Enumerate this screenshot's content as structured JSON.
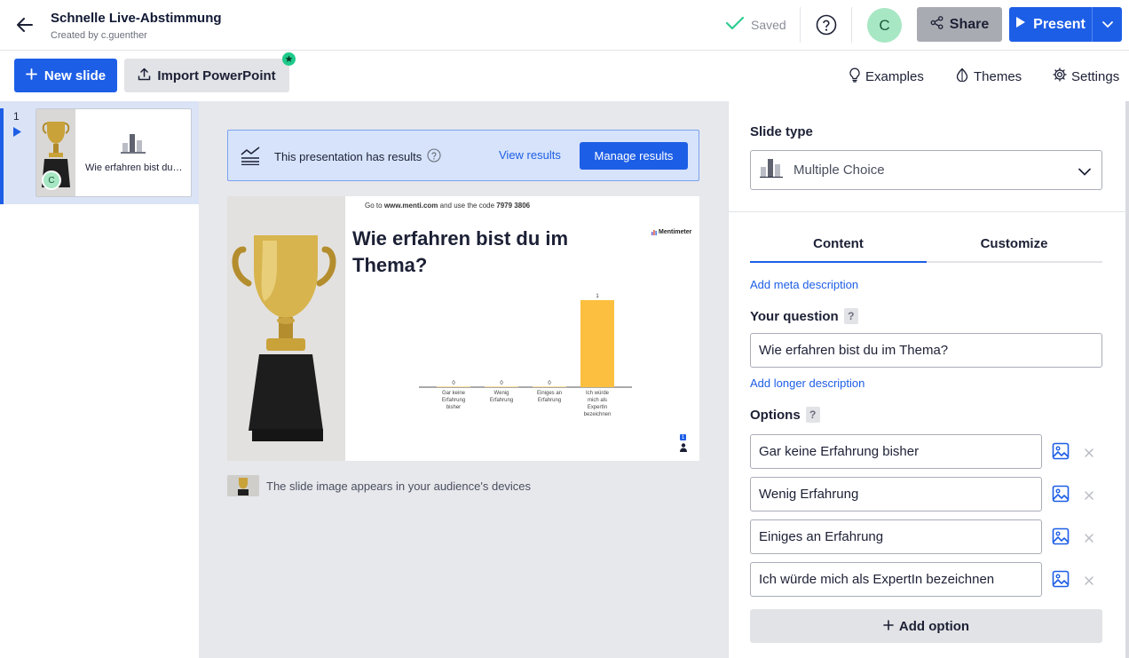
{
  "header": {
    "title": "Schnelle Live-Abstimmung",
    "created_by": "Created by c.guenther",
    "saved_label": "Saved",
    "avatar_initial": "C",
    "share_label": "Share",
    "present_label": "Present"
  },
  "toolbar": {
    "new_slide_label": "New slide",
    "import_label": "Import PowerPoint",
    "examples_label": "Examples",
    "themes_label": "Themes",
    "settings_label": "Settings"
  },
  "slides_panel": {
    "items": [
      {
        "number": "1",
        "title": "Wie erfahren bist du im Thema?",
        "avatar_initial": "C"
      }
    ]
  },
  "results_banner": {
    "text": "This presentation has results",
    "view_label": "View results",
    "manage_label": "Manage results"
  },
  "slide_preview": {
    "join_prefix": "Go to",
    "join_url": "www.menti.com",
    "join_middle": "and use the code",
    "join_code": "7979 3806",
    "question": "Wie erfahren bist du im Thema?",
    "brand": "Mentimeter",
    "audience_count": "1",
    "caption": "The slide image appears in your audience's devices"
  },
  "chart_data": {
    "type": "bar",
    "categories": [
      "Gar keine Erfahrung bisher",
      "Wenig Erfahrung",
      "Einiges an Erfahrung",
      "Ich würde mich als ExpertIn bezeichnen"
    ],
    "values": [
      0,
      0,
      0,
      1
    ],
    "colors": {
      "bar": "#fdbf3f",
      "axis": "#555555"
    }
  },
  "settings_panel": {
    "slide_type_label": "Slide type",
    "slide_type_value": "Multiple Choice",
    "tabs": [
      {
        "label": "Content"
      },
      {
        "label": "Customize"
      }
    ],
    "meta_link": "Add meta description",
    "question_label": "Your question",
    "question_value": "Wie erfahren bist du im Thema?",
    "longer_link": "Add longer description",
    "options_label": "Options",
    "options": [
      {
        "value": "Gar keine Erfahrung bisher"
      },
      {
        "value": "Wenig Erfahrung"
      },
      {
        "value": "Einiges an Erfahrung"
      },
      {
        "value": "Ich würde mich als ExpertIn bezeichnen"
      }
    ],
    "add_option_label": "Add option"
  },
  "colors": {
    "accent": "#1d5ee6",
    "avatar": "#a7e7c4",
    "saved_check": "#2ecc8f"
  }
}
